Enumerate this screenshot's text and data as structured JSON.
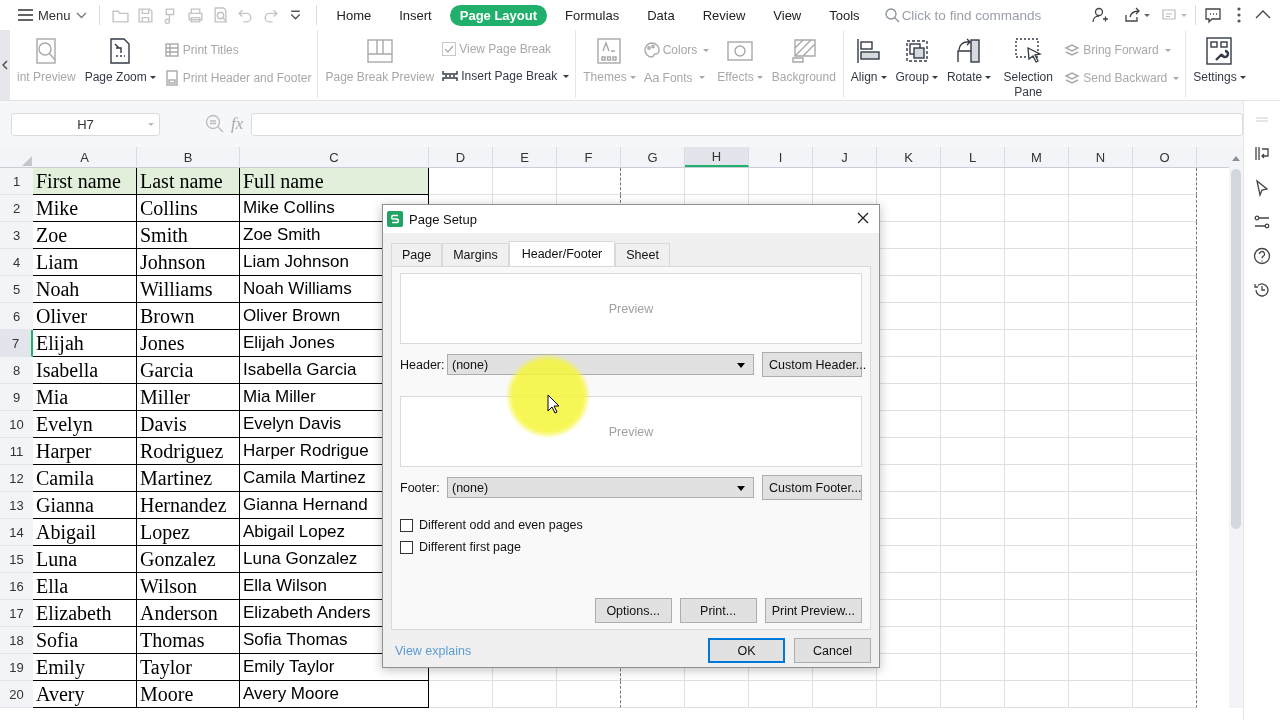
{
  "top_bar": {
    "menu": "Menu",
    "tabs": [
      {
        "label": "Home",
        "selected": false
      },
      {
        "label": "Insert",
        "selected": false
      },
      {
        "label": "Page Layout",
        "selected": true
      },
      {
        "label": "Formulas",
        "selected": false
      },
      {
        "label": "Data",
        "selected": false
      },
      {
        "label": "Review",
        "selected": false
      },
      {
        "label": "View",
        "selected": false
      },
      {
        "label": "Tools",
        "selected": false
      }
    ],
    "search": {
      "placeholder": "Click to find commands"
    }
  },
  "ribbon": [
    [
      {
        "label": "int Preview",
        "kind": "large",
        "disabled": true,
        "dropdown": false
      },
      {
        "label": "Page Zoom",
        "kind": "large",
        "disabled": false,
        "dropdown": true
      },
      {
        "label": "Print Titles",
        "kind": "small",
        "disabled": true,
        "dropdown": false
      },
      {
        "label": "Print Header and Footer",
        "kind": "small",
        "disabled": true,
        "dropdown": false
      }
    ],
    [
      {
        "label": "Page Break Preview",
        "kind": "large",
        "disabled": true,
        "dropdown": false
      },
      {
        "label": "View Page Break",
        "kind": "check",
        "disabled": true,
        "checked": true
      },
      {
        "label": "Insert Page Break",
        "kind": "small",
        "disabled": false,
        "dropdown": true
      }
    ],
    [
      {
        "label": "Themes",
        "kind": "large",
        "disabled": true,
        "dropdown": true
      },
      {
        "label": "Colors",
        "kind": "small",
        "disabled": true,
        "dropdown": true
      },
      {
        "label": "Fonts",
        "kind": "small",
        "disabled": true,
        "dropdown": true,
        "glyph": "Aa"
      },
      {
        "label": "Effects",
        "kind": "large",
        "disabled": true,
        "dropdown": true
      },
      {
        "label": "Background",
        "kind": "large",
        "disabled": true,
        "dropdown": false
      }
    ],
    [
      {
        "label": "Align",
        "kind": "large",
        "disabled": false,
        "dropdown": true
      },
      {
        "label": "Group",
        "kind": "large",
        "disabled": false,
        "dropdown": true
      },
      {
        "label": "Rotate",
        "kind": "large",
        "disabled": false,
        "dropdown": true
      },
      {
        "label": "Selection Pane",
        "kind": "large",
        "disabled": false,
        "dropdown": false
      },
      {
        "label": "Bring Forward",
        "kind": "small",
        "disabled": true,
        "dropdown": true
      },
      {
        "label": "Send Backward",
        "kind": "small",
        "disabled": true,
        "dropdown": true
      }
    ],
    [
      {
        "label": "Settings",
        "kind": "large",
        "disabled": false,
        "dropdown": true
      }
    ]
  ],
  "formula_bar": {
    "name_box": "H7",
    "fx": "fx"
  },
  "sheet": {
    "columns": [
      {
        "label": "A",
        "selected": false,
        "page_break": false
      },
      {
        "label": "B",
        "selected": false,
        "page_break": false
      },
      {
        "label": "C",
        "selected": false,
        "page_break": false
      },
      {
        "label": "D",
        "selected": false,
        "page_break": false
      },
      {
        "label": "E",
        "selected": false,
        "page_break": false
      },
      {
        "label": "F",
        "selected": false,
        "page_break": true
      },
      {
        "label": "G",
        "selected": false,
        "page_break": false
      },
      {
        "label": "H",
        "selected": true,
        "page_break": false
      },
      {
        "label": "I",
        "selected": false,
        "page_break": false
      },
      {
        "label": "J",
        "selected": false,
        "page_break": false
      },
      {
        "label": "K",
        "selected": false,
        "page_break": false
      },
      {
        "label": "L",
        "selected": false,
        "page_break": false
      },
      {
        "label": "M",
        "selected": false,
        "page_break": false
      },
      {
        "label": "N",
        "selected": false,
        "page_break": false
      },
      {
        "label": "O",
        "selected": false,
        "page_break": true
      }
    ],
    "rows": [
      {
        "number": "1",
        "selected": false,
        "kind": "header",
        "cells": [
          "First name",
          "Last name",
          "Full name"
        ]
      },
      {
        "number": "2",
        "selected": false,
        "kind": "data",
        "cells": [
          "Mike",
          "Collins",
          "Mike Collins"
        ]
      },
      {
        "number": "3",
        "selected": false,
        "kind": "data",
        "cells": [
          "Zoe",
          "Smith",
          "Zoe Smith"
        ]
      },
      {
        "number": "4",
        "selected": false,
        "kind": "data",
        "cells": [
          "Liam",
          "Johnson",
          "Liam Johnson"
        ]
      },
      {
        "number": "5",
        "selected": false,
        "kind": "data",
        "cells": [
          "Noah",
          "Williams",
          "Noah Williams"
        ]
      },
      {
        "number": "6",
        "selected": false,
        "kind": "data",
        "cells": [
          "Oliver",
          "Brown",
          "Oliver Brown"
        ]
      },
      {
        "number": "7",
        "selected": true,
        "kind": "data",
        "cells": [
          "Elijah",
          "Jones",
          "Elijah Jones"
        ]
      },
      {
        "number": "8",
        "selected": false,
        "kind": "data",
        "cells": [
          "Isabella",
          "Garcia",
          "Isabella Garcia"
        ]
      },
      {
        "number": "9",
        "selected": false,
        "kind": "data",
        "cells": [
          "Mia",
          "Miller",
          "Mia Miller"
        ]
      },
      {
        "number": "10",
        "selected": false,
        "kind": "data",
        "cells": [
          "Evelyn",
          "Davis",
          "Evelyn Davis"
        ]
      },
      {
        "number": "11",
        "selected": false,
        "kind": "data",
        "cells": [
          "Harper",
          "Rodriguez",
          "Harper Rodrigue"
        ]
      },
      {
        "number": "12",
        "selected": false,
        "kind": "data",
        "cells": [
          "Camila",
          "Martinez",
          "Camila Martinez"
        ]
      },
      {
        "number": "13",
        "selected": false,
        "kind": "data",
        "cells": [
          "Gianna",
          "Hernandez",
          "Gianna Hernand"
        ]
      },
      {
        "number": "14",
        "selected": false,
        "kind": "data",
        "cells": [
          "Abigail",
          "Lopez",
          "Abigail Lopez"
        ]
      },
      {
        "number": "15",
        "selected": false,
        "kind": "data",
        "cells": [
          "Luna",
          "Gonzalez",
          "Luna Gonzalez"
        ]
      },
      {
        "number": "16",
        "selected": false,
        "kind": "data",
        "cells": [
          "Ella",
          "Wilson",
          "Ella Wilson"
        ]
      },
      {
        "number": "17",
        "selected": false,
        "kind": "data",
        "cells": [
          "Elizabeth",
          "Anderson",
          "Elizabeth Anders"
        ]
      },
      {
        "number": "18",
        "selected": false,
        "kind": "data",
        "cells": [
          "Sofia",
          "Thomas",
          "Sofia Thomas"
        ]
      },
      {
        "number": "19",
        "selected": false,
        "kind": "data",
        "cells": [
          "Emily",
          "Taylor",
          "Emily Taylor"
        ]
      },
      {
        "number": "20",
        "selected": false,
        "kind": "data",
        "cells": [
          "Avery",
          "Moore",
          "Avery Moore"
        ]
      }
    ]
  },
  "dialog": {
    "title": "Page Setup",
    "tabs": [
      {
        "label": "Page",
        "selected": false
      },
      {
        "label": "Margins",
        "selected": false
      },
      {
        "label": "Header/Footer",
        "selected": true
      },
      {
        "label": "Sheet",
        "selected": false
      }
    ],
    "header_preview": "Preview",
    "header_label": "Header:",
    "header_value": "(none)",
    "header_button": "Custom Header...",
    "footer_preview": "Preview",
    "footer_label": "Footer:",
    "footer_value": "(none)",
    "footer_button": "Custom Footer...",
    "options": [
      {
        "label": "Different odd and even pages",
        "checked": false
      },
      {
        "label": "Different first page",
        "checked": false
      }
    ],
    "panel_buttons": [
      "Options...",
      "Print...",
      "Print Preview..."
    ],
    "link": "View explains",
    "ok": "OK",
    "cancel": "Cancel"
  }
}
